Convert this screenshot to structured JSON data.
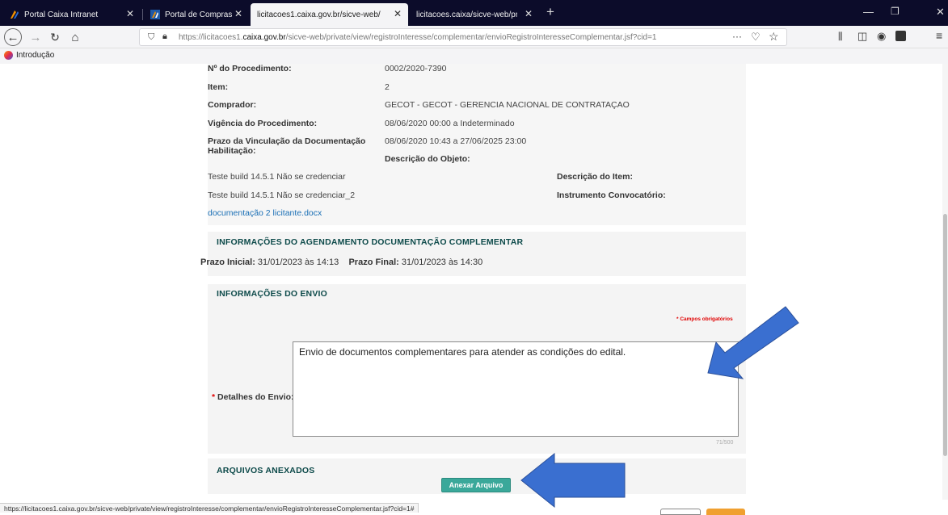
{
  "browser": {
    "tabs": [
      {
        "title": "Portal Caixa Intranet",
        "icon": "caixa-x-icon"
      },
      {
        "title": "Portal de Compras",
        "icon": "caixa-x-icon"
      },
      {
        "title": "licitacoes1.caixa.gov.br/sicve-web/",
        "active": true
      },
      {
        "title": "licitacoes.caixa/sicve-web/private/"
      }
    ],
    "url_prefix": "https://licitacoes1.",
    "url_domain": "caixa.gov.br",
    "url_path": "/sicve-web/private/view/registroInteresse/complementar/envioRegistroInteresseComplementar.jsf?cid=1",
    "url_more": "···",
    "bookmark": "Introdução",
    "accent_color": "#0c0c2a"
  },
  "procedure": {
    "rows": [
      {
        "label": "Nº do Procedimento:",
        "value": "0002/2020-7390"
      },
      {
        "label": "Item:",
        "value": "2"
      },
      {
        "label": "Comprador:",
        "value": "GECOT - GECOT - GERENCIA NACIONAL DE CONTRATAÇAO"
      },
      {
        "label": "Vigência do Procedimento:",
        "value": "08/06/2020 00:00 a Indeterminado"
      },
      {
        "label": "Prazo da Vinculação da Documentação Habilitação:",
        "value": "08/06/2020 10:43 a 27/06/2025 23:00"
      }
    ],
    "descricao_objeto_label": "Descrição do Objeto:",
    "descricao_item_label": "Descrição do Item:",
    "instrumento_label": "Instrumento Convocatório:",
    "doc_lines": [
      "Teste build 14.5.1 Não se credenciar",
      "Teste build 14.5.1 Não se credenciar_2"
    ],
    "doc_link": "documentação 2 licitante.docx"
  },
  "agendamento": {
    "title": "INFORMAÇÕES DO AGENDAMENTO DOCUMENTAÇÃO COMPLEMENTAR",
    "prazo_inicial_label": "Prazo Inicial:",
    "prazo_inicial": "31/01/2023 às 14:13",
    "prazo_final_label": "Prazo Final:",
    "prazo_final": "31/01/2023 às 14:30"
  },
  "envio": {
    "title": "INFORMAÇÕES DO ENVIO",
    "required_note": "* Campos obrigatórios",
    "detalhes_label": "Detalhes do Envio:",
    "detalhes_value": "Envio de documentos complementares para atender as condições do edital.",
    "counter": "71/500"
  },
  "anexos": {
    "title": "ARQUIVOS ANEXADOS",
    "button": "Anexar Arquivo"
  },
  "status_url": "https://licitacoes1.caixa.gov.br/sicve-web/private/view/registroInteresse/complementar/envioRegistroInteresseComplementar.jsf?cid=1#",
  "annotation_color": "#3a6fd0"
}
